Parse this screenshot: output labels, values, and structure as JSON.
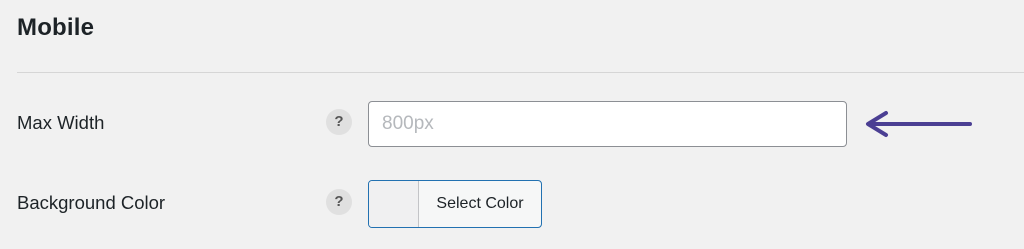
{
  "section": {
    "title": "Mobile"
  },
  "fields": {
    "max_width": {
      "label": "Max Width",
      "help": "?",
      "value": "",
      "placeholder": "800px"
    },
    "background_color": {
      "label": "Background Color",
      "help": "?",
      "button_label": "Select Color"
    }
  },
  "annotation": {
    "icon": "arrow-left-icon",
    "color": "#4b3f93"
  },
  "colors": {
    "background": "#f1f1f1",
    "input_border": "#8c8f94",
    "focus_border": "#2271b1"
  }
}
